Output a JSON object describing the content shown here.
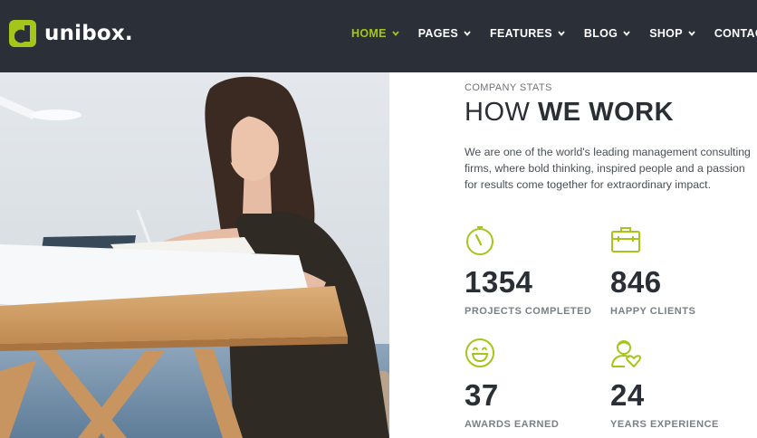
{
  "brand": {
    "name": "unibox."
  },
  "nav": [
    {
      "label": "HOME",
      "active": true
    },
    {
      "label": "PAGES",
      "active": false
    },
    {
      "label": "FEATURES",
      "active": false
    },
    {
      "label": "BLOG",
      "active": false
    },
    {
      "label": "SHOP",
      "active": false
    },
    {
      "label": "CONTACT",
      "active": false
    }
  ],
  "section": {
    "kicker": "COMPANY STATS",
    "title_light": "HOW ",
    "title_bold": "WE WORK",
    "description": "We are one of the world's leading management consulting firms, where bold thinking, inspired people and a passion for results come together for extraordinary impact."
  },
  "stats": [
    {
      "icon": "stopwatch-icon",
      "number": "1354",
      "label": "PROJECTS COMPLETED"
    },
    {
      "icon": "briefcase-icon",
      "number": "846",
      "label": "HAPPY CLIENTS"
    },
    {
      "icon": "smiley-icon",
      "number": "37",
      "label": "AWARDS EARNED"
    },
    {
      "icon": "user-heart-icon",
      "number": "24",
      "label": "YEARS EXPERIENCE"
    }
  ],
  "colors": {
    "accent": "#a4c61a",
    "header_bg": "#2a2f38",
    "heading": "#2a2f36",
    "muted": "#7b8086"
  }
}
